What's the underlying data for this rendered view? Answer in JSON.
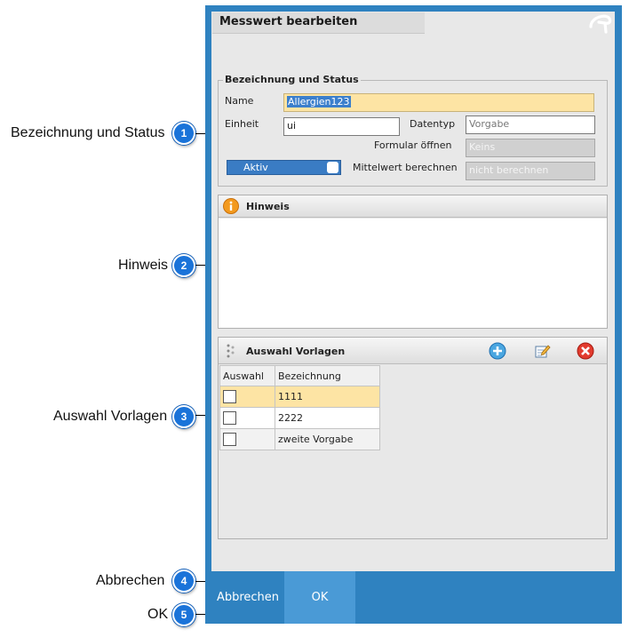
{
  "callouts": [
    {
      "num": "1",
      "label": "Bezeichnung und Status"
    },
    {
      "num": "2",
      "label": "Hinweis"
    },
    {
      "num": "3",
      "label": "Auswahl Vorlagen"
    },
    {
      "num": "4",
      "label": "Abbrechen"
    },
    {
      "num": "5",
      "label": "OK"
    }
  ],
  "dialog": {
    "title": "Messwert bearbeiten",
    "logo_icon": "brand-logo-icon",
    "status_section": {
      "legend": "Bezeichnung und Status",
      "name_label": "Name",
      "name_value": "Allergien123",
      "einheit_label": "Einheit",
      "einheit_value": "ui",
      "datentyp_label": "Datentyp",
      "datentyp_value": "Vorgabe",
      "formular_label": "Formular öffnen",
      "formular_value": "Keins",
      "aktiv_label": "Aktiv",
      "mittelwert_label": "Mittelwert berechnen",
      "mittelwert_value": "nicht berechnen"
    },
    "hinweis": {
      "title": "Hinweis",
      "icon": "info-icon",
      "text": ""
    },
    "vorlagen": {
      "title": "Auswahl Vorlagen",
      "icons": [
        "drag-handle-icon",
        "add-icon",
        "edit-icon",
        "delete-icon"
      ],
      "columns": [
        "Auswahl",
        "Bezeichnung"
      ],
      "rows": [
        {
          "bezeichnung": "1111"
        },
        {
          "bezeichnung": "2222"
        },
        {
          "bezeichnung": "zweite Vorgabe"
        }
      ]
    },
    "footer": {
      "cancel_label": "Abbrechen",
      "ok_label": "OK"
    }
  },
  "colors": {
    "dialog_blue": "#2f82c0",
    "button_highlight": "#4a9ad6",
    "selection_yellow": "#fde4a4",
    "callout_badge": "#1a73d9"
  }
}
